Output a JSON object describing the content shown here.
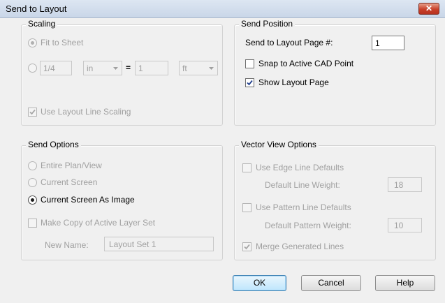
{
  "window": {
    "title": "Send to Layout",
    "close_glyph": "✕"
  },
  "scaling": {
    "title": "Scaling",
    "fit_to_sheet": "Fit to Sheet",
    "ratio_value": "1/4",
    "ratio_unit": "in",
    "equals": "=",
    "scale_value": "1",
    "scale_unit": "ft",
    "use_layout_line_scaling": "Use Layout Line Scaling"
  },
  "send_position": {
    "title": "Send Position",
    "page_label": "Send to Layout Page #:",
    "page_value": "1",
    "snap_label": "Snap to Active CAD Point",
    "show_label": "Show Layout Page"
  },
  "send_options": {
    "title": "Send Options",
    "entire_plan": "Entire Plan/View",
    "current_screen": "Current Screen",
    "current_screen_image": "Current Screen As Image",
    "make_copy": "Make Copy of Active Layer Set",
    "new_name_label": "New Name:",
    "new_name_value": "Layout Set 1"
  },
  "vector_view": {
    "title": "Vector View Options",
    "use_edge": "Use Edge Line Defaults",
    "line_weight_label": "Default Line Weight:",
    "line_weight_value": "18",
    "use_pattern": "Use Pattern Line Defaults",
    "pattern_weight_label": "Default Pattern Weight:",
    "pattern_weight_value": "10",
    "merge_lines": "Merge Generated Lines"
  },
  "buttons": {
    "ok": "OK",
    "cancel": "Cancel",
    "help": "Help"
  },
  "state": {
    "fit_to_sheet_selected": true,
    "use_layout_line_scaling_checked": true,
    "snap_checked": false,
    "show_layout_page_checked": true,
    "send_option_selected": "Current Screen As Image",
    "make_copy_checked": false,
    "use_edge_checked": false,
    "use_pattern_checked": false,
    "merge_lines_checked": true
  }
}
